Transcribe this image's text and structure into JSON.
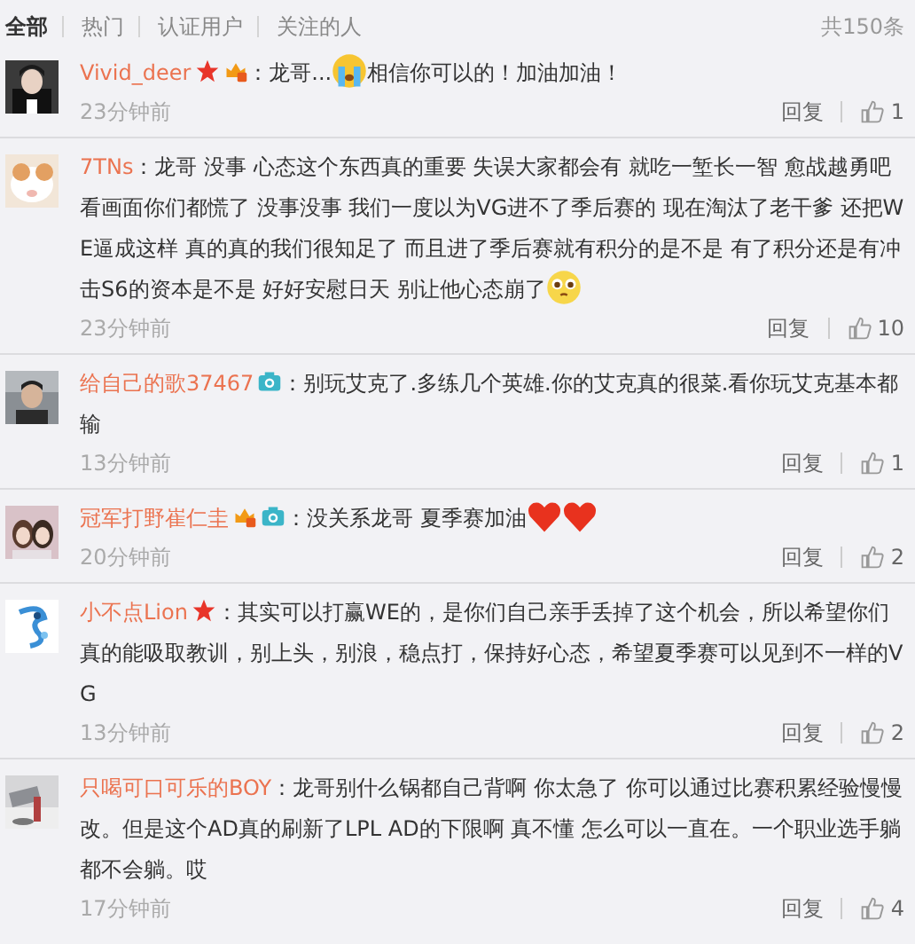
{
  "tabs": [
    {
      "label": "全部",
      "selected": true
    },
    {
      "label": "热门",
      "selected": false
    },
    {
      "label": "认证用户",
      "selected": false
    },
    {
      "label": "关注的人",
      "selected": false
    }
  ],
  "total": "共150条",
  "comments": [
    {
      "user": "Vivid_deer",
      "badges": [
        {
          "kind": "star"
        },
        {
          "kind": "vip"
        }
      ],
      "content": [
        {
          "kind": "text",
          "text": "：龙哥..."
        },
        {
          "kind": "crying"
        },
        {
          "kind": "text",
          "text": "相信你可以的！加油加油！"
        }
      ],
      "time": "23分钟前",
      "reply": "回复",
      "likes": "1"
    },
    {
      "user": "7TNs",
      "content": [
        {
          "kind": "text",
          "text": "：龙哥 没事 心态这个东西真的重要 失误大家都会有 就吃一堑长一智 愈战越勇吧看画面你们都慌了 没事没事 我们一度以为VG进不了季后赛的 现在淘汰了老干爹 还把WE逼成这样 真的真的我们很知足了  而且进了季后赛就有积分的是不是 有了积分还是有冲击S6的资本是不是  好好安慰日天 别让他心态崩了"
        },
        {
          "kind": "pleading"
        }
      ],
      "time": "23分钟前",
      "reply": "回复",
      "likes": "10"
    },
    {
      "user": "给自己的歌37467",
      "badges": [
        {
          "kind": "camera"
        }
      ],
      "content": [
        {
          "kind": "text",
          "text": "：别玩艾克了.多练几个英雄.你的艾克真的很菜.看你玩艾克基本都输"
        }
      ],
      "time": "13分钟前",
      "reply": "回复",
      "likes": "1"
    },
    {
      "user": "冠军打野崔仁圭",
      "badges": [
        {
          "kind": "vip"
        },
        {
          "kind": "camera"
        }
      ],
      "content": [
        {
          "kind": "text",
          "text": "：没关系龙哥 夏季赛加油"
        },
        {
          "kind": "heart"
        },
        {
          "kind": "heart"
        }
      ],
      "time": "20分钟前",
      "reply": "回复",
      "likes": "2"
    },
    {
      "user": "小不点Lion",
      "badges": [
        {
          "kind": "star"
        }
      ],
      "content": [
        {
          "kind": "text",
          "text": "：其实可以打赢WE的，是你们自己亲手丢掉了这个机会，所以希望你们真的能吸取教训，别上头，别浪，稳点打，保持好心态，希望夏季赛可以见到不一样的VG"
        }
      ],
      "time": "13分钟前",
      "reply": "回复",
      "likes": "2"
    },
    {
      "user": "只喝可口可乐的BOY",
      "content": [
        {
          "kind": "text",
          "text": "：龙哥别什么锅都自己背啊  你太急了 你可以通过比赛积累经验慢慢改。但是这个AD真的刷新了LPL AD的下限啊  真不懂  怎么可以一直在。一个职业选手躺都不会躺。哎"
        }
      ],
      "time": "17分钟前",
      "reply": "回复",
      "likes": "4"
    }
  ]
}
